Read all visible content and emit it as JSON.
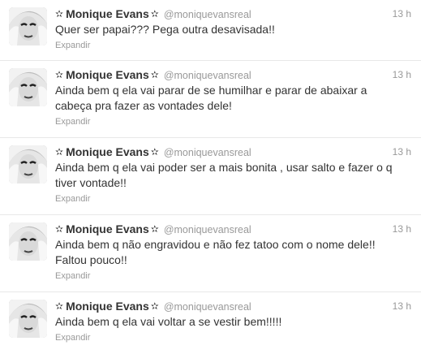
{
  "tweets": [
    {
      "fullname": "Monique Evans",
      "username": "@moniquevansreal",
      "timestamp": "13 h",
      "text": "Quer ser papai??? Pega outra desavisada!!",
      "expand_label": "Expandir"
    },
    {
      "fullname": "Monique Evans",
      "username": "@moniquevansreal",
      "timestamp": "13 h",
      "text": "Ainda bem q ela vai parar de se humilhar e parar de abaixar a cabeça pra fazer as vontades dele!",
      "expand_label": "Expandir"
    },
    {
      "fullname": "Monique Evans",
      "username": "@moniquevansreal",
      "timestamp": "13 h",
      "text": "Ainda bem q ela vai poder ser a mais bonita , usar salto e fazer o q tiver vontade!!",
      "expand_label": "Expandir"
    },
    {
      "fullname": "Monique Evans",
      "username": "@moniquevansreal",
      "timestamp": "13 h",
      "text": "Ainda bem q não engravidou e não fez tatoo com o nome dele!! Faltou pouco!!",
      "expand_label": "Expandir"
    },
    {
      "fullname": "Monique Evans",
      "username": "@moniquevansreal",
      "timestamp": "13 h",
      "text": "Ainda bem q ela vai voltar a se vestir bem!!!!!",
      "expand_label": "Expandir"
    }
  ],
  "icons": {
    "name_star": "star-icon"
  },
  "colors": {
    "text": "#333333",
    "muted": "#999999",
    "divider": "#e8e8e8"
  }
}
